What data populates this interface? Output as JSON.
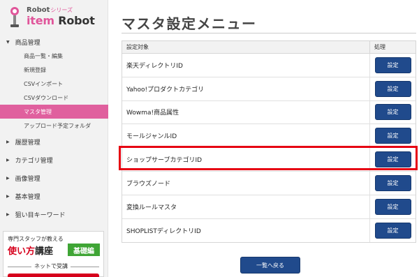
{
  "logo": {
    "top": "Robot",
    "series": "シリーズ",
    "item": "item",
    "robot": " Robot"
  },
  "nav": {
    "product": "商品管理",
    "product_sub": [
      "商品一覧・編集",
      "新規登録",
      "CSVインポート",
      "CSVダウンロード",
      "マスタ管理",
      "アップロード予定フォルダ"
    ],
    "history": "履歴管理",
    "category": "カテゴリ管理",
    "image": "画像管理",
    "basic": "基本管理",
    "keyword": "狙い目キーワード"
  },
  "promo": {
    "line1": "専門スタッフが教える",
    "red": "使い方",
    "dark": "講座",
    "tag": "基礎編",
    "line3": "ネットで受講"
  },
  "page": {
    "title": "マスタ設定メニュー",
    "back_label": "一覧へ戻る"
  },
  "table": {
    "header_target": "設定対象",
    "header_action": "処理",
    "button_label": "設定",
    "rows": [
      "楽天ディレクトリID",
      "Yahoo!プロダクトカテゴリ",
      "Wowma!商品属性",
      "モールジャンルID",
      "ショップサーブカテゴリID",
      "ブラウズノード",
      "変換ルールマスタ",
      "SHOPLISTディレクトリID"
    ]
  },
  "colors": {
    "accent_pink": "#e0609e",
    "button_blue": "#204a8c",
    "highlight_red": "#e60012"
  }
}
